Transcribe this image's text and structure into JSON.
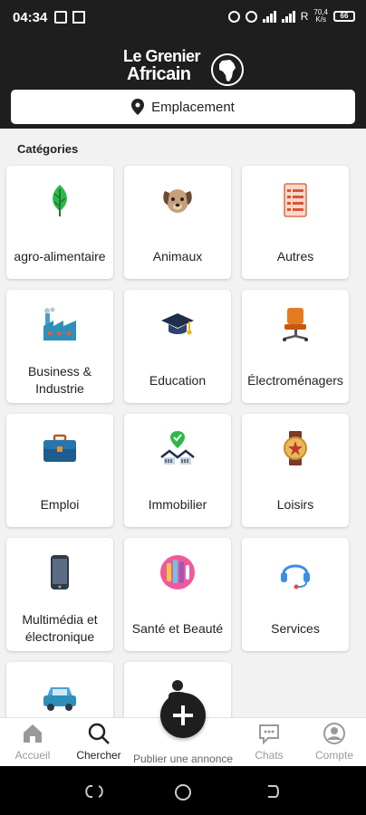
{
  "status_bar": {
    "time": "04:34",
    "net_speed_top": "70,4",
    "net_speed_bottom": "K/s",
    "network_letter": "R",
    "battery": "66"
  },
  "header": {
    "logo_line1": "Le Grenier",
    "logo_line2": "Africain",
    "location_label": "Emplacement"
  },
  "categories": {
    "title": "Catégories",
    "items": [
      {
        "label": "agro-alimentaire",
        "icon": "leaf-icon"
      },
      {
        "label": "Animaux",
        "icon": "dog-icon"
      },
      {
        "label": "Autres",
        "icon": "checklist-icon"
      },
      {
        "label": "Business & Industrie",
        "icon": "factory-icon"
      },
      {
        "label": "Education",
        "icon": "graduation-cap-icon"
      },
      {
        "label": "Électroménagers",
        "icon": "office-chair-icon"
      },
      {
        "label": "Emploi",
        "icon": "briefcase-icon"
      },
      {
        "label": "Immobilier",
        "icon": "real-estate-icon"
      },
      {
        "label": "Loisirs",
        "icon": "watch-icon"
      },
      {
        "label": "Multimédia et électronique",
        "icon": "smartphone-icon"
      },
      {
        "label": "Santé et Beauté",
        "icon": "beauty-icon"
      },
      {
        "label": "Services",
        "icon": "headset-icon"
      },
      {
        "label": "",
        "icon": "car-icon"
      },
      {
        "label": "",
        "icon": "person-icon"
      }
    ]
  },
  "bottom_nav": {
    "home": "Accueil",
    "search": "Chercher",
    "publish": "Publier une annonce",
    "chats": "Chats",
    "account": "Compte"
  }
}
